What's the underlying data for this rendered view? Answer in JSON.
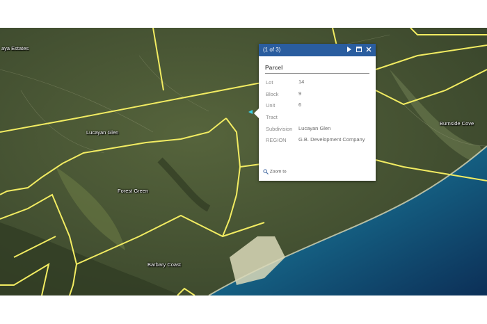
{
  "map": {
    "labels": {
      "estates": "aya Estates",
      "lucayan_glen": "Lucayan Glen",
      "forest_green": "Forest Green",
      "barbary_coast": "Barbary Coast",
      "burnside_cove": "Burnside Cove"
    },
    "colors": {
      "boundary": "#f2ec62",
      "land": "#4a5636",
      "sea_deep": "#0e3a63",
      "sea_shallow": "#2f9aa8",
      "beach": "#d9d8b8"
    }
  },
  "popup": {
    "title": "(1 of 3)",
    "next_icon": "play-icon",
    "maximize_icon": "maximize-icon",
    "close_icon": "close-icon",
    "heading": "Parcel",
    "fields": [
      {
        "label": "Lot",
        "value": "14"
      },
      {
        "label": "Block",
        "value": "9"
      },
      {
        "label": "Unit",
        "value": "6"
      },
      {
        "label": "Tract",
        "value": ""
      },
      {
        "label": "Subdivision",
        "value": "Lucayan Glen"
      },
      {
        "label": "REGION",
        "value": "G.B. Development Company"
      }
    ],
    "zoom_label": "Zoom to",
    "colors": {
      "titlebar": "#2a5d9f"
    }
  }
}
